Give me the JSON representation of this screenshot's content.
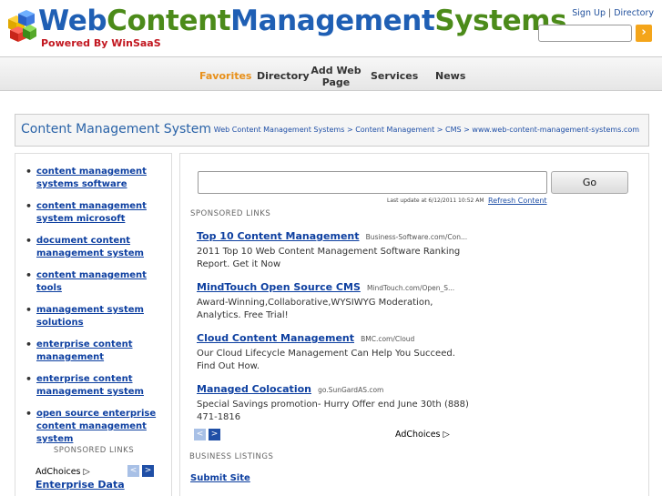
{
  "header": {
    "logo_text_a": "Web",
    "logo_text_b": "Content",
    "logo_text_c": "Management",
    "logo_text_d": "Systems",
    "tagline": "Powered By WinSaaS",
    "sign_up": "Sign Up",
    "link_separator": "|",
    "directory": "Directory",
    "search_value": "",
    "go_icon": "chevron-right-icon",
    "go_glyph": "›"
  },
  "nav": {
    "items": [
      {
        "label": "Favorites",
        "active": true
      },
      {
        "label": "Directory"
      },
      {
        "label": "Add Web Page"
      },
      {
        "label": "Services"
      },
      {
        "label": "News"
      }
    ]
  },
  "title_band": {
    "title": "Content Management System",
    "breadcrumb": [
      "Web Content Management Systems",
      "Content Management",
      "CMS",
      "www.web-content-management-systems.com"
    ],
    "breadcrumb_separator": ">"
  },
  "left_panel": {
    "links": [
      "content management systems software",
      "content management system microsoft",
      "document content management system",
      "content management tools",
      "management system solutions",
      "enterprise content management",
      "enterprise content management system",
      "open source enterprise content management system"
    ],
    "sponsored_label": "SPONSORED LINKS",
    "adchoices": "AdChoices",
    "ad_link": "Enterprise Data",
    "prev_glyph": "<",
    "next_glyph": ">"
  },
  "main": {
    "search_value": "",
    "go_label": "Go",
    "last_update": "Last update at 6/12/2011 10:52 AM",
    "refresh_label": "Refresh Content",
    "sponsored_label": "SPONSORED LINKS",
    "ads": [
      {
        "title": "Top 10 Content Management",
        "url": "Business-Software.com/Con...",
        "desc": "2011 Top 10 Web Content Management Software Ranking Report. Get it Now"
      },
      {
        "title": "MindTouch Open Source CMS",
        "url": "MindTouch.com/Open_S...",
        "desc": "Award-Winning,Collaborative,WYSIWYG Moderation, Analytics. Free Trial!"
      },
      {
        "title": "Cloud Content Management",
        "url": "BMC.com/Cloud",
        "desc": "Our Cloud Lifecycle Management Can Help You Succeed. Find Out How."
      },
      {
        "title": "Managed Colocation",
        "url": "go.SunGardAS.com",
        "desc": "Special Savings promotion- Hurry Offer end June 30th (888) 471-1816"
      }
    ],
    "adchoices": "AdChoices",
    "business_listings": "BUSINESS LISTINGS",
    "submit_site": "Submit Site",
    "prev_glyph": "<",
    "next_glyph": ">"
  },
  "colors": {
    "brand_blue": "#1f5fb4",
    "brand_green": "#4c8b1a",
    "tagline_red": "#c2161f",
    "nav_active": "#e8901a",
    "link_blue": "#0d3fa0"
  }
}
